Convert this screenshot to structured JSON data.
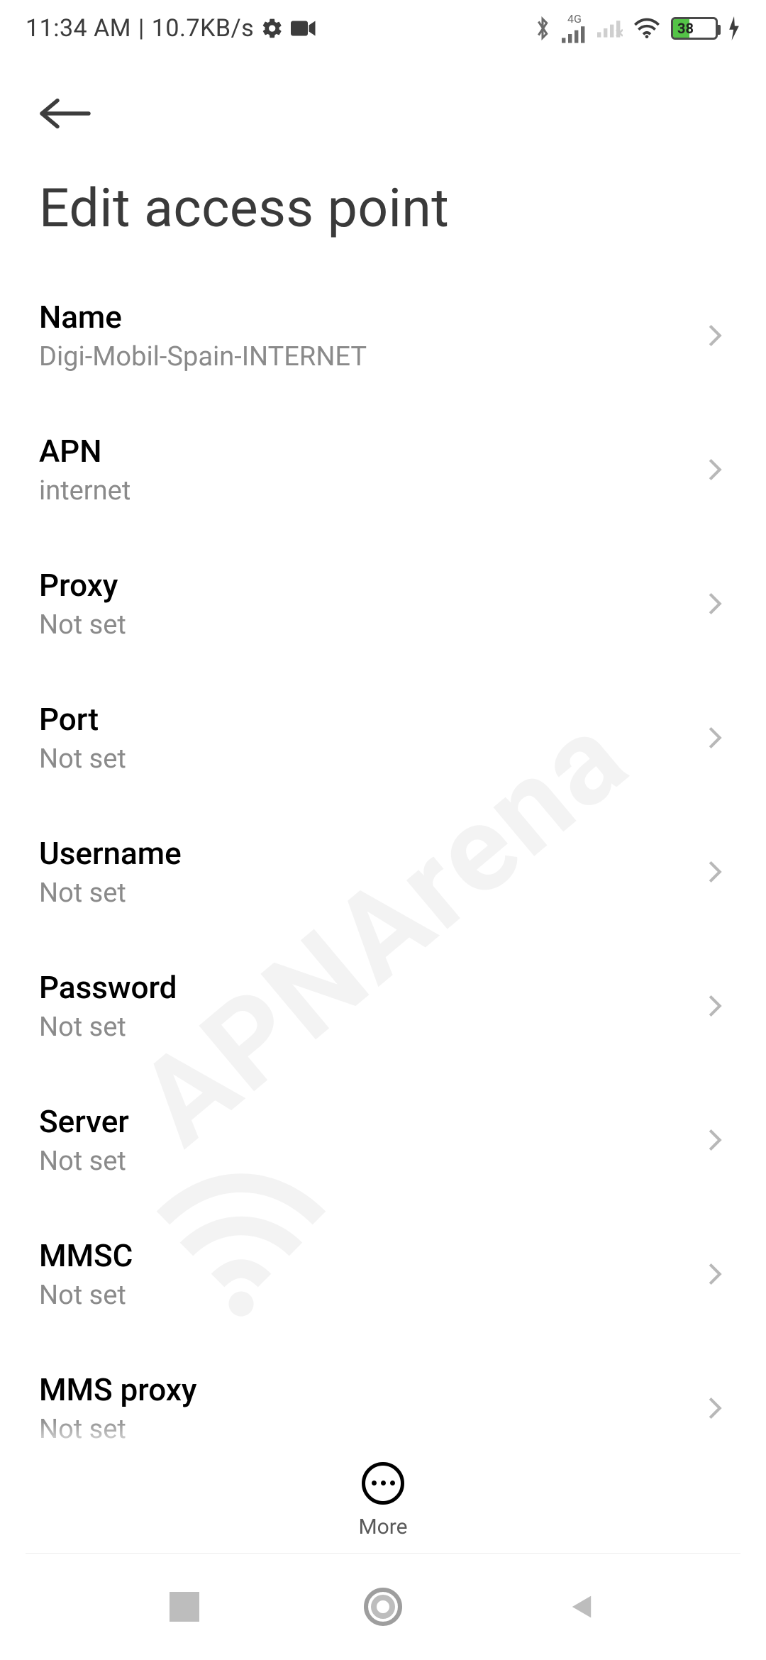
{
  "status": {
    "time": "11:34 AM",
    "separator": "|",
    "net_speed": "10.7KB/s",
    "battery_percent": "38",
    "network_badge": "4G"
  },
  "header": {
    "title": "Edit access point"
  },
  "rows": [
    {
      "label": "Name",
      "value": "Digi-Mobil-Spain-INTERNET"
    },
    {
      "label": "APN",
      "value": "internet"
    },
    {
      "label": "Proxy",
      "value": "Not set"
    },
    {
      "label": "Port",
      "value": "Not set"
    },
    {
      "label": "Username",
      "value": "Not set"
    },
    {
      "label": "Password",
      "value": "Not set"
    },
    {
      "label": "Server",
      "value": "Not set"
    },
    {
      "label": "MMSC",
      "value": "Not set"
    },
    {
      "label": "MMS proxy",
      "value": "Not set"
    }
  ],
  "bottom": {
    "more_label": "More"
  },
  "watermark": {
    "text": "APNArena"
  }
}
